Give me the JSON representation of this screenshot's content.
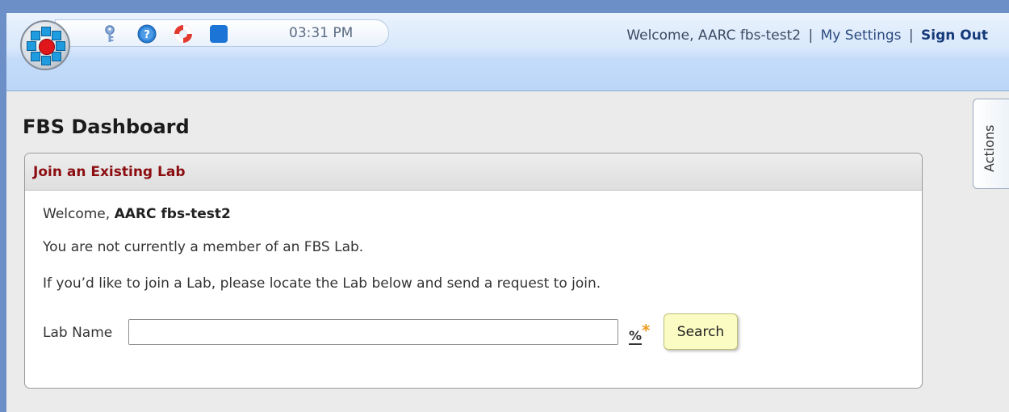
{
  "header": {
    "clock": "03:31 PM",
    "welcome_prefix": "Welcome, AARC fbs-test2",
    "separator": "|",
    "my_settings": "My Settings",
    "sign_out": "Sign Out",
    "toolbar_icons": [
      "app-logo-icon",
      "key-icon",
      "help-icon",
      "lifebuoy-icon",
      "blue-square-icon"
    ]
  },
  "page": {
    "title": "FBS Dashboard"
  },
  "panel": {
    "heading": "Join an Existing Lab",
    "welcome_label": "Welcome, ",
    "welcome_name": "AARC fbs-test2",
    "not_member": "You are not currently a member of an FBS Lab.",
    "instructions": "If you’d like to join a Lab, please locate the Lab below and send a request to join.",
    "lab_name_label": "Lab Name",
    "lab_name_value": "",
    "wildcard_percent": "%",
    "wildcard_star": "*",
    "search_button": "Search"
  },
  "side_tab": {
    "label": "Actions"
  },
  "colors": {
    "panel_heading": "#8b0d10",
    "search_button_bg": "#fbfcc3",
    "header_bg": "#c4dcfa",
    "outer_border": "#6b8fc6"
  }
}
